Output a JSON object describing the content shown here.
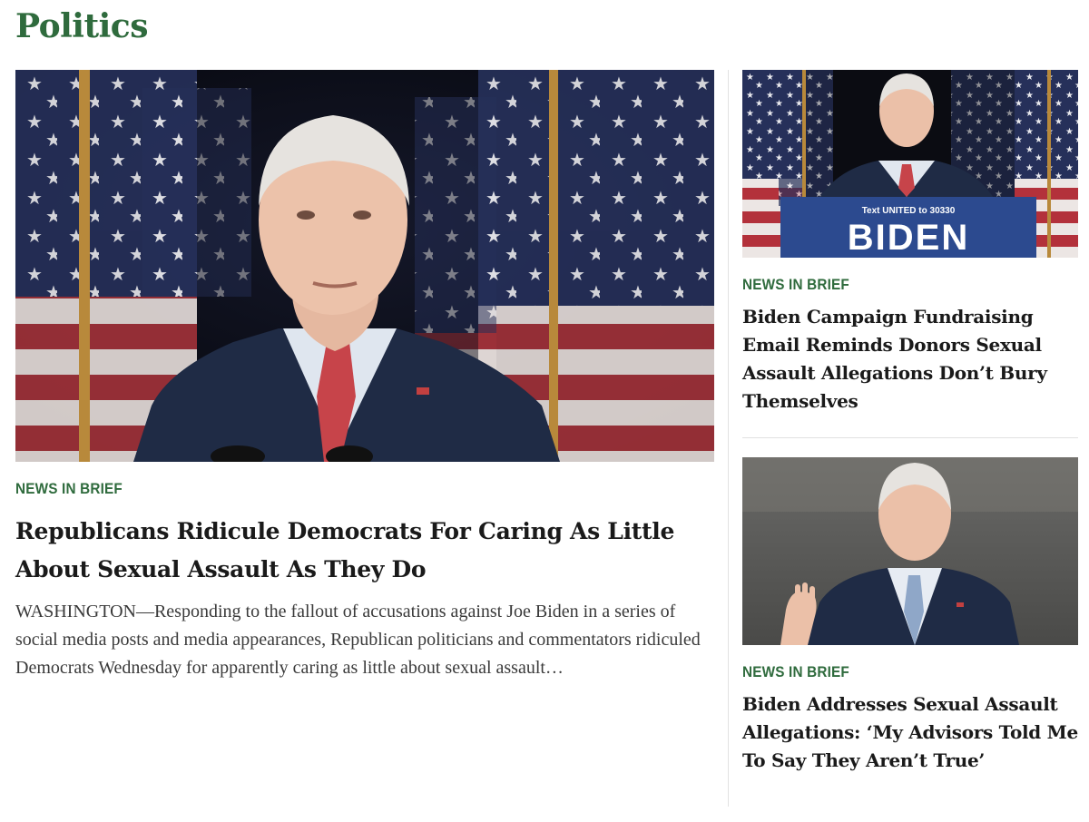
{
  "section": {
    "title": "Politics"
  },
  "lead": {
    "kicker": "NEWS IN BRIEF",
    "headline": "Republicans Ridicule Democrats For Caring As Little About Sexual Assault As They Do",
    "excerpt": "WASHINGTON—Responding to the fallout of accusations against Joe Biden in a series of social media posts and media appearances, Republican politicians and commentators ridiculed Democrats Wednesday for apparently caring as little about sexual assault…"
  },
  "side_stories": [
    {
      "kicker": "NEWS IN BRIEF",
      "headline": "Biden Campaign Fundraising Email Reminds Donors Sexual Assault Allegations Don’t Bury Themselves",
      "image_text": {
        "small": "Text UNITED to 30330",
        "big": "BIDEN"
      }
    },
    {
      "kicker": "NEWS IN BRIEF",
      "headline": "Biden Addresses Sexual Assault Allegations: ‘My Advisors Told Me To Say They Aren’t True’"
    }
  ],
  "colors": {
    "accent": "#2f6b3d",
    "flag_red": "#b3313b",
    "flag_blue": "#1d2b55",
    "podium_blue": "#2c4a8f",
    "suit": "#1f2b45"
  }
}
